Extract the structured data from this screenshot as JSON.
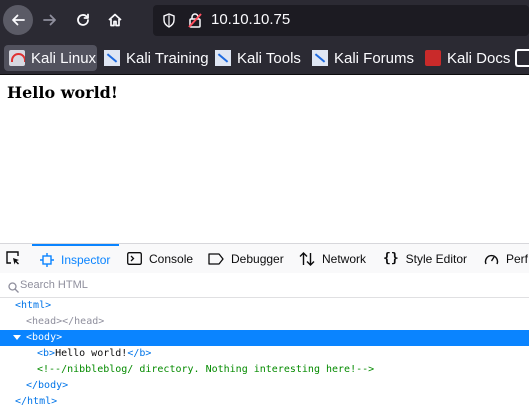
{
  "browser": {
    "url": "10.10.10.75",
    "bookmarks": [
      {
        "label": "Kali Linux",
        "icon": "kali-icon"
      },
      {
        "label": "Kali Training",
        "icon": "bookmark-tile-icon"
      },
      {
        "label": "Kali Tools",
        "icon": "bookmark-tile-icon"
      },
      {
        "label": "Kali Forums",
        "icon": "bookmark-tile-icon"
      },
      {
        "label": "Kali Docs",
        "icon": "docs-icon"
      }
    ]
  },
  "page": {
    "heading": "Hello world!"
  },
  "devtools": {
    "tabs": {
      "inspector": "Inspector",
      "console": "Console",
      "debugger": "Debugger",
      "network": "Network",
      "style_editor": "Style Editor",
      "performance": "Perf"
    },
    "search_placeholder": "Search HTML",
    "tree": {
      "html_open": "<html>",
      "head": "<head></head>",
      "body_open": "<body>",
      "b_open": "<b>",
      "b_text": "Hello world!",
      "b_close": "</b>",
      "comment": "<!--/nibbleblog/ directory. Nothing interesting here!-->",
      "body_close": "</body>",
      "html_close": "</html>"
    }
  },
  "colors": {
    "toolbar": "#2b2a33",
    "urlbar": "#1c1b22",
    "accent": "#0a84ff",
    "tag": "#0074e8",
    "comment": "#058b00"
  }
}
